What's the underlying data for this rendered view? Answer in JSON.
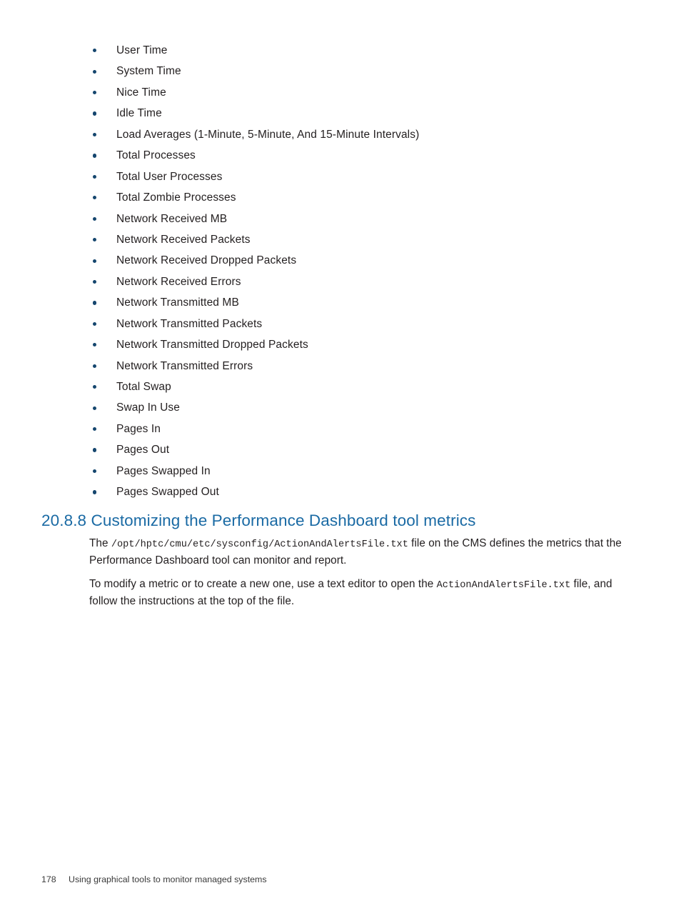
{
  "page": {
    "number": "178",
    "footer_chapter_title": "Using graphical tools to monitor managed systems",
    "background_color": "#ffffff",
    "body_text_color": "#231f20",
    "heading_color": "#1a6aa4",
    "bullet_color": "#15466e"
  },
  "metrics_list": {
    "items": [
      "User Time",
      "System Time",
      "Nice Time",
      "Idle Time",
      "Load Averages (1-Minute, 5-Minute, And 15-Minute Intervals)",
      "Total Processes",
      "Total User Processes",
      "Total Zombie Processes",
      "Network Received MB",
      "Network Received Packets",
      "Network Received Dropped Packets",
      "Network Received Errors",
      "Network Transmitted MB",
      "Network Transmitted Packets",
      "Network Transmitted Dropped Packets",
      "Network Transmitted Errors",
      "Total Swap",
      "Swap In Use",
      "Pages In",
      "Pages Out",
      "Pages Swapped In",
      "Pages Swapped Out"
    ]
  },
  "section": {
    "number": "20.8.8",
    "title": "Customizing the Performance Dashboard tool metrics",
    "heading_full": "20.8.8 Customizing the Performance Dashboard tool metrics",
    "paragraph_1": {
      "before_path": "The ",
      "path": "/opt/hptc/cmu/etc/sysconfig/ActionAndAlertsFile.txt",
      "after_path": " file on the CMS defines the metrics that the Performance Dashboard tool can monitor and report."
    },
    "paragraph_2": {
      "before_file": "To modify a metric or to create a new one, use a text editor to open the ",
      "file": "ActionAndAlertsFile.txt",
      "after_file": " file, and follow the instructions at the top of the file."
    }
  }
}
